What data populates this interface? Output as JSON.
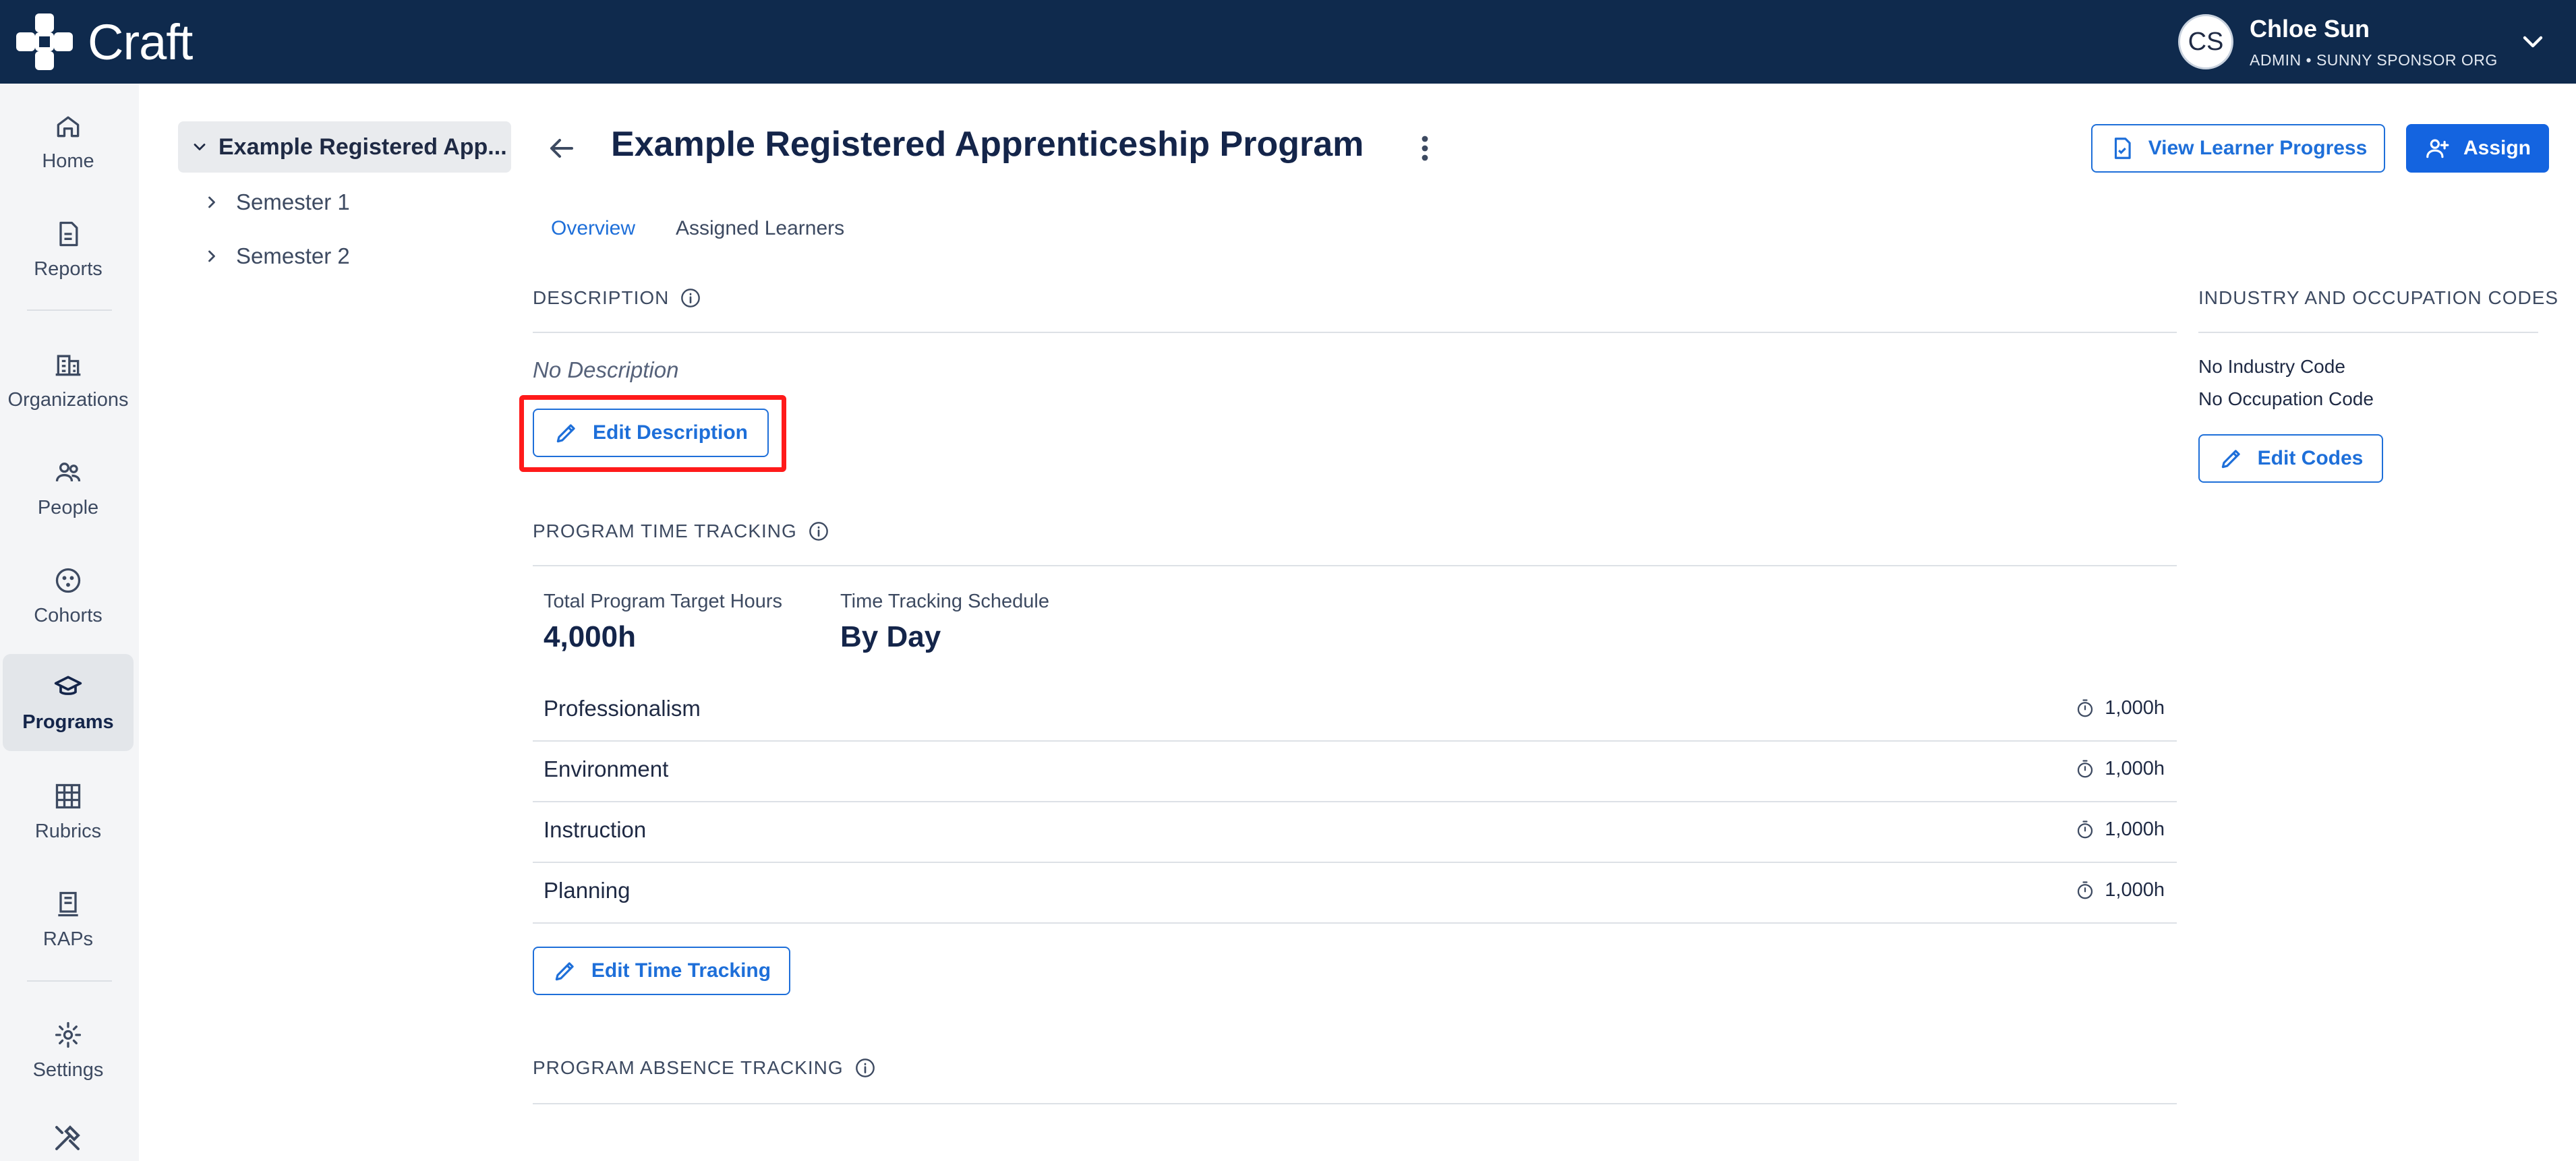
{
  "app": {
    "logo_text": "Craft"
  },
  "user": {
    "initials": "CS",
    "name": "Chloe Sun",
    "role": "ADMIN • SUNNY SPONSOR ORG"
  },
  "nav": {
    "items": [
      {
        "label": "Home",
        "icon": "home-icon"
      },
      {
        "label": "Reports",
        "icon": "reports-icon"
      },
      {
        "label": "Organizations",
        "icon": "organizations-icon"
      },
      {
        "label": "People",
        "icon": "people-icon"
      },
      {
        "label": "Cohorts",
        "icon": "cohorts-icon"
      },
      {
        "label": "Programs",
        "icon": "programs-icon",
        "active": true
      },
      {
        "label": "Rubrics",
        "icon": "rubrics-icon"
      },
      {
        "label": "RAPs",
        "icon": "raps-icon"
      },
      {
        "label": "Settings",
        "icon": "gear-icon"
      }
    ]
  },
  "tree": {
    "root": "Example Registered App...",
    "children": [
      "Semester 1",
      "Semester 2"
    ]
  },
  "header": {
    "title": "Example Registered Apprenticeship Program",
    "view_progress_label": "View Learner Progress",
    "assign_label": "Assign"
  },
  "tabs": [
    {
      "label": "Overview",
      "active": true
    },
    {
      "label": "Assigned Learners",
      "active": false
    }
  ],
  "description": {
    "heading": "DESCRIPTION",
    "value": "No Description",
    "edit_label": "Edit Description"
  },
  "codes": {
    "heading": "INDUSTRY AND OCCUPATION CODES",
    "industry": "No Industry Code",
    "occupation": "No Occupation Code",
    "edit_label": "Edit Codes"
  },
  "time_tracking": {
    "heading": "PROGRAM TIME TRACKING",
    "target_label": "Total Program Target Hours",
    "target_value": "4,000h",
    "schedule_label": "Time Tracking Schedule",
    "schedule_value": "By Day",
    "rows": [
      {
        "name": "Professionalism",
        "hours": "1,000h"
      },
      {
        "name": "Environment",
        "hours": "1,000h"
      },
      {
        "name": "Instruction",
        "hours": "1,000h"
      },
      {
        "name": "Planning",
        "hours": "1,000h"
      }
    ],
    "edit_label": "Edit Time Tracking"
  },
  "absence": {
    "heading": "PROGRAM ABSENCE TRACKING"
  },
  "colors": {
    "topbar": "#0f2a4d",
    "accent": "#1464e0",
    "highlight": "#ff1a1a"
  }
}
